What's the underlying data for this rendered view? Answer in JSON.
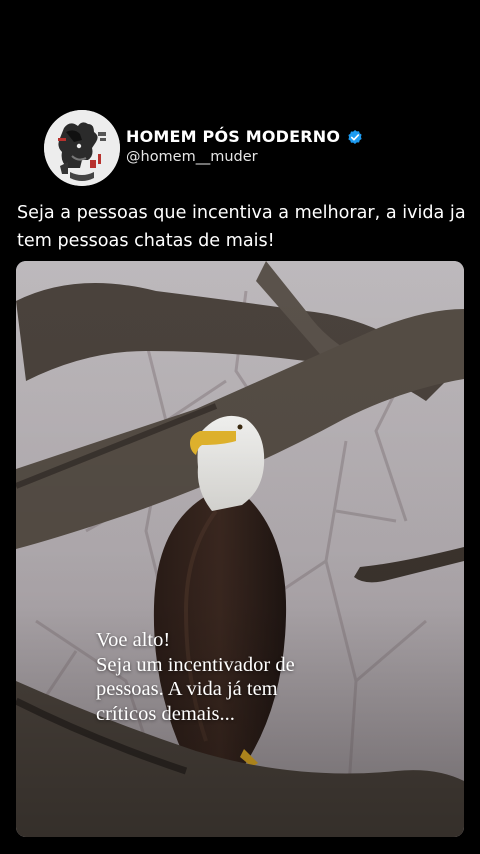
{
  "post": {
    "author": {
      "display_name": "HOMEM PÓS MODERNO",
      "handle": "@homem__muder",
      "verified": true,
      "verified_icon": "verified-badge-icon",
      "verified_color": "#1d9bf0"
    },
    "text": "Seja a pessoas que incentiva a melhorar, a ivida ja tem pessoas chatas de mais!",
    "media": {
      "overlay_lines": [
        "Voe alto!",
        "Seja um incentivador de",
        "pessoas. A vida já tem",
        "críticos demais..."
      ]
    }
  },
  "colors": {
    "background": "#000000",
    "text": "#ffffff",
    "handle": "#e6e6e6"
  }
}
